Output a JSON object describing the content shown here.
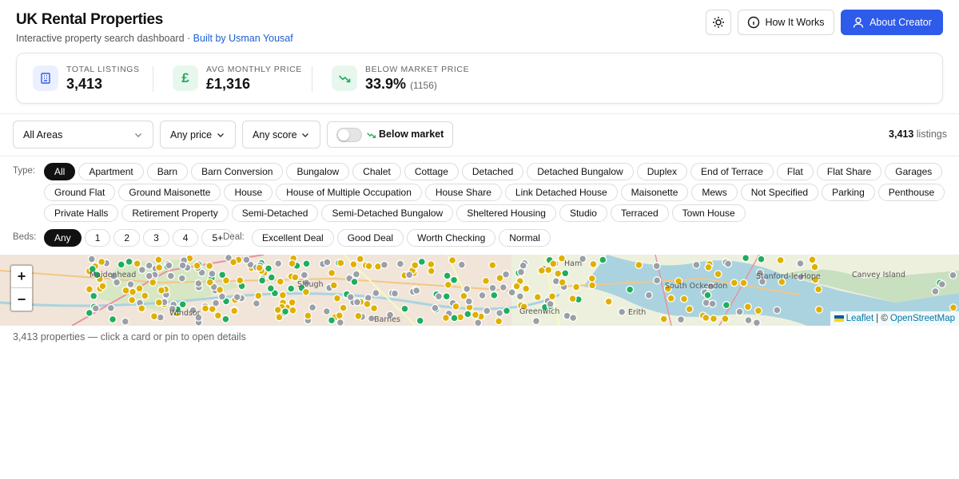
{
  "header": {
    "title": "UK Rental Properties",
    "subtitle": "Interactive property search dashboard ·",
    "subtitle_link": "Built by Usman Yousaf",
    "how_label": "How It Works",
    "about_label": "About Creator"
  },
  "stats": [
    {
      "label": "Total Listings",
      "value": "3,413",
      "sub": ""
    },
    {
      "label": "Avg Monthly Price",
      "value": "£1,316",
      "sub": ""
    },
    {
      "label": "Below Market Price",
      "value": "33.9%",
      "sub": "(1156)"
    }
  ],
  "filters": {
    "area": "All Areas",
    "price": "Any price",
    "score": "Any score",
    "below_market": "Below market",
    "count_value": "3,413",
    "count_label": "listings"
  },
  "type_label": "Type:",
  "types": [
    "All",
    "Apartment",
    "Barn",
    "Barn Conversion",
    "Bungalow",
    "Chalet",
    "Cottage",
    "Detached",
    "Detached Bungalow",
    "Duplex",
    "End of Terrace",
    "Flat",
    "Flat Share",
    "Garages",
    "Ground Flat",
    "Ground Maisonette",
    "House",
    "House of Multiple Occupation",
    "House Share",
    "Link Detached House",
    "Maisonette",
    "Mews",
    "Not Specified",
    "Parking",
    "Penthouse",
    "Private Halls",
    "Retirement Property",
    "Semi-Detached",
    "Semi-Detached Bungalow",
    "Sheltered Housing",
    "Studio",
    "Terraced",
    "Town House"
  ],
  "beds_label": "Beds:",
  "beds": [
    "Any",
    "1",
    "2",
    "3",
    "4",
    "5+"
  ],
  "deal_label": "Deal:",
  "deals": [
    "Excellent Deal",
    "Good Deal",
    "Worth Checking",
    "Normal"
  ],
  "map": {
    "zoom_in": "+",
    "zoom_out": "−",
    "places": [
      "Maidenhead",
      "Windsor",
      "Slough",
      "Barnes",
      "Greenwich",
      "Erith",
      "South Ockendon",
      "Stanford-le-Hope",
      "Canvey Island",
      "Ham"
    ],
    "attrib_leaflet": "Leaflet",
    "attrib_sep": "| ©",
    "attrib_osm": "OpenStreetMap"
  },
  "footer_note": "3,413 properties — click a card or pin to open details",
  "colors": {
    "accent": "#2f5bea",
    "pin_excellent": "#1fae5e",
    "pin_good": "#e0b000",
    "pin_normal": "#9aa0a6"
  }
}
